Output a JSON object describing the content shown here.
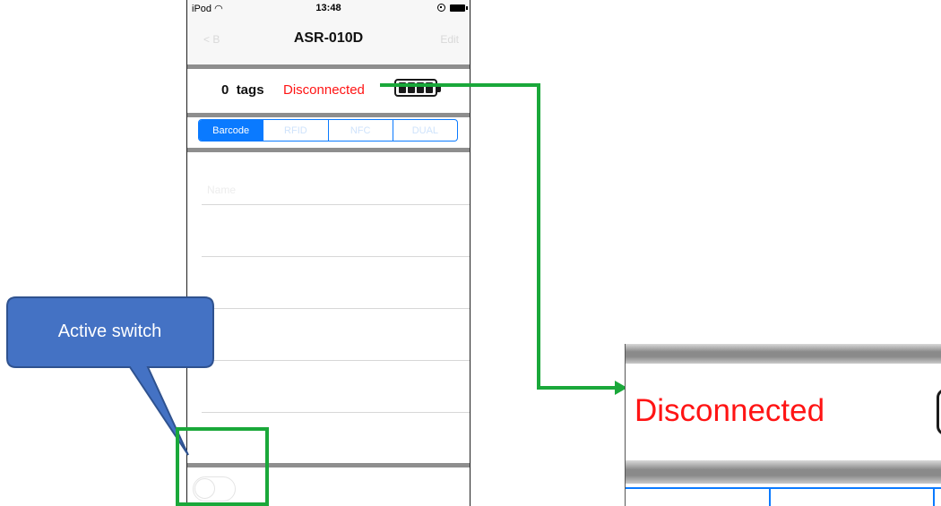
{
  "status_bar": {
    "carrier": "iPod",
    "time": "13:48"
  },
  "nav": {
    "title": "ASR-010D",
    "back_label": "< B",
    "right_label": "Edit"
  },
  "reader_status": {
    "tag_count": "0",
    "tag_unit": "tags",
    "connection": "Disconnected",
    "battery_cells": 4
  },
  "mode_tabs": [
    "Barcode",
    "RFID",
    "NFC",
    "DUAL"
  ],
  "selected_mode": "Barcode",
  "list_first_item": "Name",
  "active_switch_on": false,
  "callout": {
    "text": "Active switch"
  },
  "zoom": {
    "connection": "Disconnected"
  },
  "colors": {
    "disconnected": "#ff1414",
    "ios_blue": "#0a7aff",
    "callout_fill": "#4472c4",
    "highlight_green": "#1aa83a"
  }
}
